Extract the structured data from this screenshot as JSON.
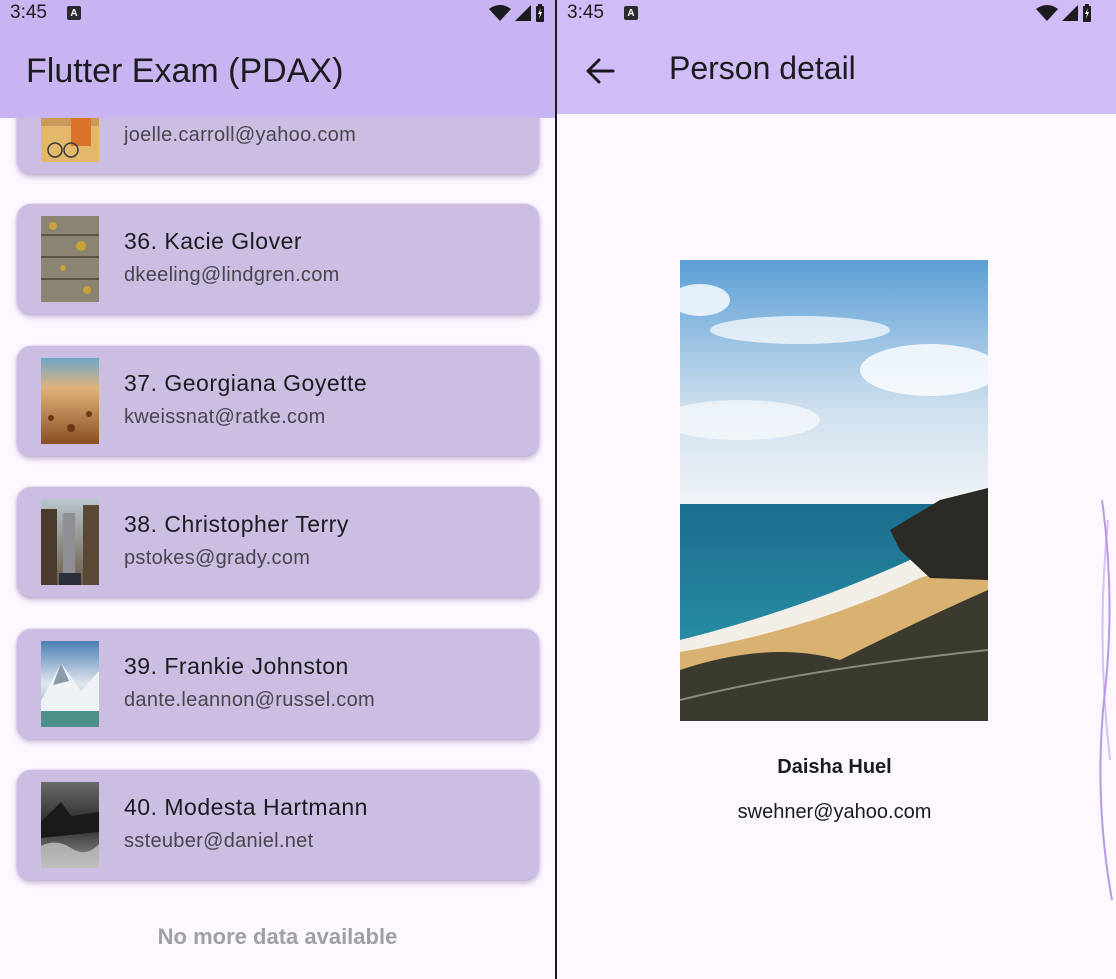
{
  "left_screen": {
    "status": {
      "time": "3:45",
      "app_icon_letter": "A"
    },
    "app_bar": {
      "title": "Flutter Exam (PDAX)"
    },
    "list": {
      "items": [
        {
          "name": "",
          "email": "joelle.carroll@yahoo.com",
          "thumbnail": "bicycle-street-photo"
        },
        {
          "name": "36. Kacie Glover",
          "email": "dkeeling@lindgren.com",
          "thumbnail": "wood-texture-photo"
        },
        {
          "name": "37. Georgiana Goyette",
          "email": "kweissnat@ratke.com",
          "thumbnail": "beach-sand-photo"
        },
        {
          "name": "38. Christopher Terry",
          "email": "pstokes@grady.com",
          "thumbnail": "city-buildings-photo"
        },
        {
          "name": "39. Frankie Johnston",
          "email": "dante.leannon@russel.com",
          "thumbnail": "snowy-mountain-photo"
        },
        {
          "name": "40. Modesta Hartmann",
          "email": "ssteuber@daniel.net",
          "thumbnail": "stormy-sea-photo"
        }
      ],
      "footer": "No more data available"
    }
  },
  "right_screen": {
    "status": {
      "time": "3:45",
      "app_icon_letter": "A"
    },
    "app_bar": {
      "title": "Person detail",
      "back_icon": "arrow-left-icon"
    },
    "detail": {
      "photo": "coastline-beach-photo",
      "name": "Daisha Huel",
      "email": "swehner@yahoo.com"
    }
  },
  "colors": {
    "app_bar_left": "#c9b4f2",
    "app_bar_right": "#d0bdf7",
    "card_background": "#cbbee2",
    "page_background": "#fdf7ff",
    "footer_text": "#a19fa3"
  }
}
